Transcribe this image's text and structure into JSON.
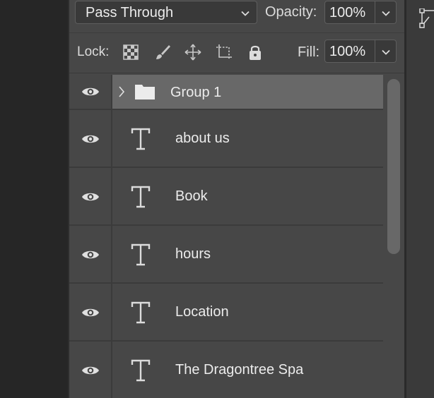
{
  "blend": {
    "mode": "Pass Through",
    "opacity_label": "Opacity:",
    "opacity_value": "100%"
  },
  "lock": {
    "label": "Lock:",
    "icons": [
      "lock-transparent-pixels-icon",
      "lock-image-pixels-icon",
      "lock-position-icon",
      "lock-artboard-icon",
      "lock-all-icon"
    ],
    "fill_label": "Fill:",
    "fill_value": "100%"
  },
  "layers": {
    "group": {
      "name": "Group 1",
      "visible": true,
      "expanded": false
    },
    "items": [
      {
        "name": "about us",
        "type": "text",
        "visible": true
      },
      {
        "name": "Book",
        "type": "text",
        "visible": true
      },
      {
        "name": "hours",
        "type": "text",
        "visible": true
      },
      {
        "name": "Location",
        "type": "text",
        "visible": true
      },
      {
        "name": "The Dragontree Spa",
        "type": "text",
        "visible": true
      }
    ]
  },
  "colors": {
    "panel_bg": "#474747",
    "selected_group_bg": "#686868",
    "field_bg": "#393939",
    "text": "#ececec"
  }
}
